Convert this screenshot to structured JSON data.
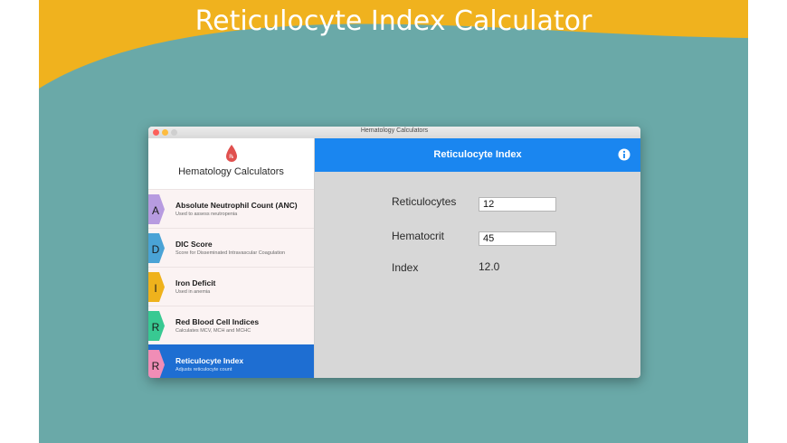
{
  "banner": {
    "title": "Reticulocyte Index Calculator",
    "color": "#f0b21e"
  },
  "window": {
    "title": "Hematology Calculators",
    "traffic_lights": [
      "close",
      "minimize",
      "zoom"
    ]
  },
  "sidebar": {
    "app_icon": "blood-drop-icon",
    "title": "Hematology Calculators",
    "items": [
      {
        "letter": "A",
        "label": "Absolute Neutrophil Count (ANC)",
        "desc": "Used to assess neutropenia",
        "color": "#b79be0",
        "active": false
      },
      {
        "letter": "D",
        "label": "DIC Score",
        "desc": "Score for Disseminated Intravascular Coagulation",
        "color": "#4aa3d6",
        "active": false
      },
      {
        "letter": "I",
        "label": "Iron Deficit",
        "desc": "Used in anemia",
        "color": "#efb21c",
        "active": false
      },
      {
        "letter": "R",
        "label": "Red Blood Cell Indices",
        "desc": "Calculates MCV, MCH and MCHC",
        "color": "#38c992",
        "active": false
      },
      {
        "letter": "R",
        "label": "Reticulocyte Index",
        "desc": "Adjusts reticulocyte count",
        "color": "#f08db6",
        "active": true
      }
    ]
  },
  "main": {
    "title": "Reticulocyte Index",
    "info_icon": "info-icon",
    "fields": {
      "reticulocytes": {
        "label": "Reticulocytes",
        "value": "12"
      },
      "hematocrit": {
        "label": "Hematocrit",
        "value": "45"
      }
    },
    "result": {
      "label": "Index",
      "value": "12.0"
    }
  }
}
